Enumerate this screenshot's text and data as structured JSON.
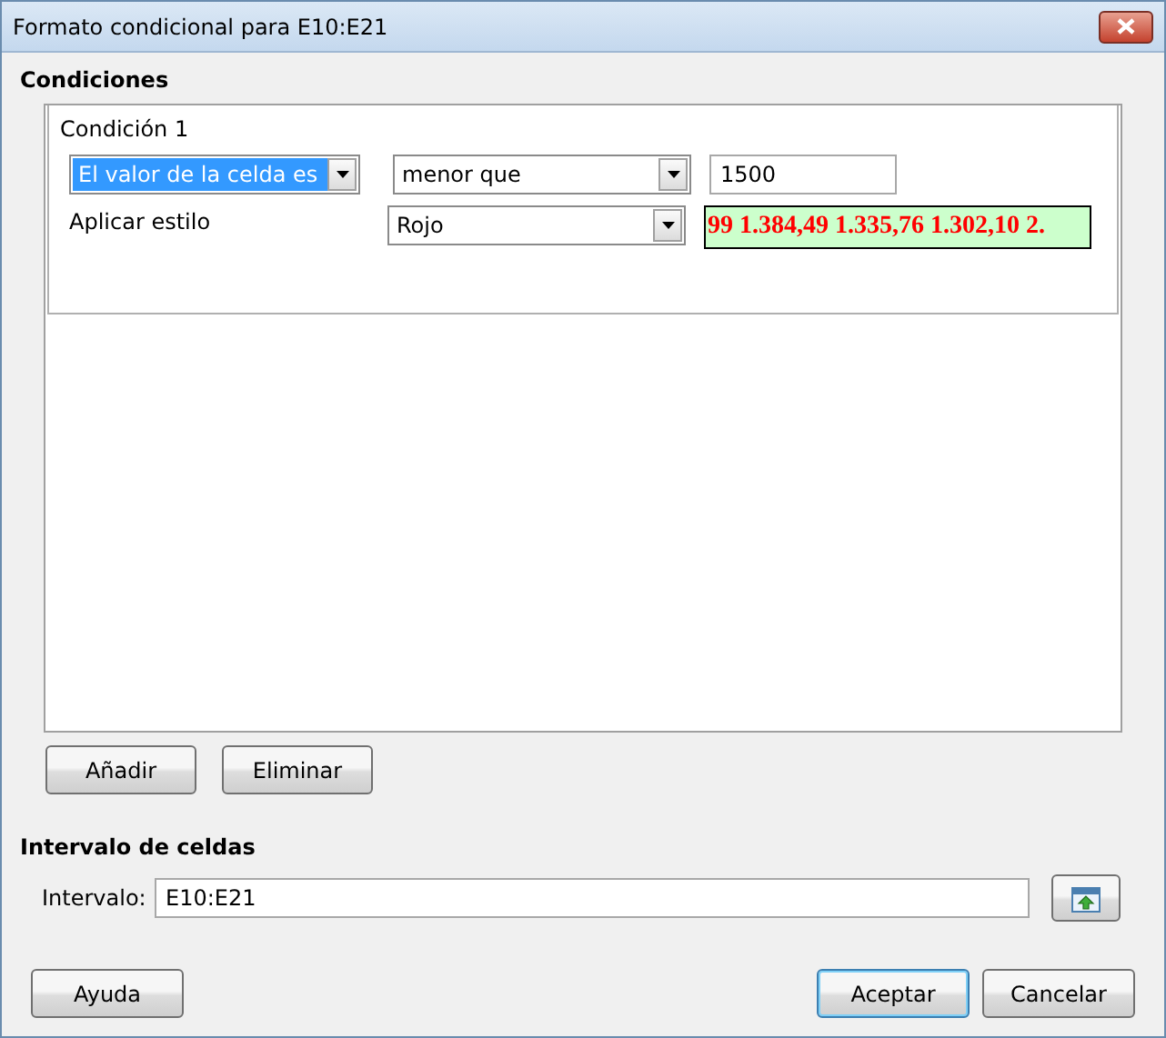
{
  "window": {
    "title": "Formato condicional para E10:E21"
  },
  "conditions": {
    "heading": "Condiciones",
    "items": [
      {
        "title": "Condición 1",
        "type_select": {
          "value": "El valor de la celda es",
          "highlighted": true
        },
        "operator_select": {
          "value": "menor que",
          "highlighted": false
        },
        "value_field": {
          "value": "1500"
        },
        "style_label": "Aplicar estilo",
        "style_select": {
          "value": "Rojo",
          "highlighted": false
        },
        "preview": "99 1.384,49 1.335,76 1.302,10 2."
      }
    ]
  },
  "list_buttons": [
    "Añadir",
    "Eliminar"
  ],
  "range": {
    "heading": "Intervalo de celdas",
    "label": "Intervalo:",
    "value": "E10:E21"
  },
  "footer_buttons": [
    {
      "label": "Ayuda",
      "default": false
    },
    {
      "label": "Aceptar",
      "default": true
    },
    {
      "label": "Cancelar",
      "default": false
    }
  ]
}
